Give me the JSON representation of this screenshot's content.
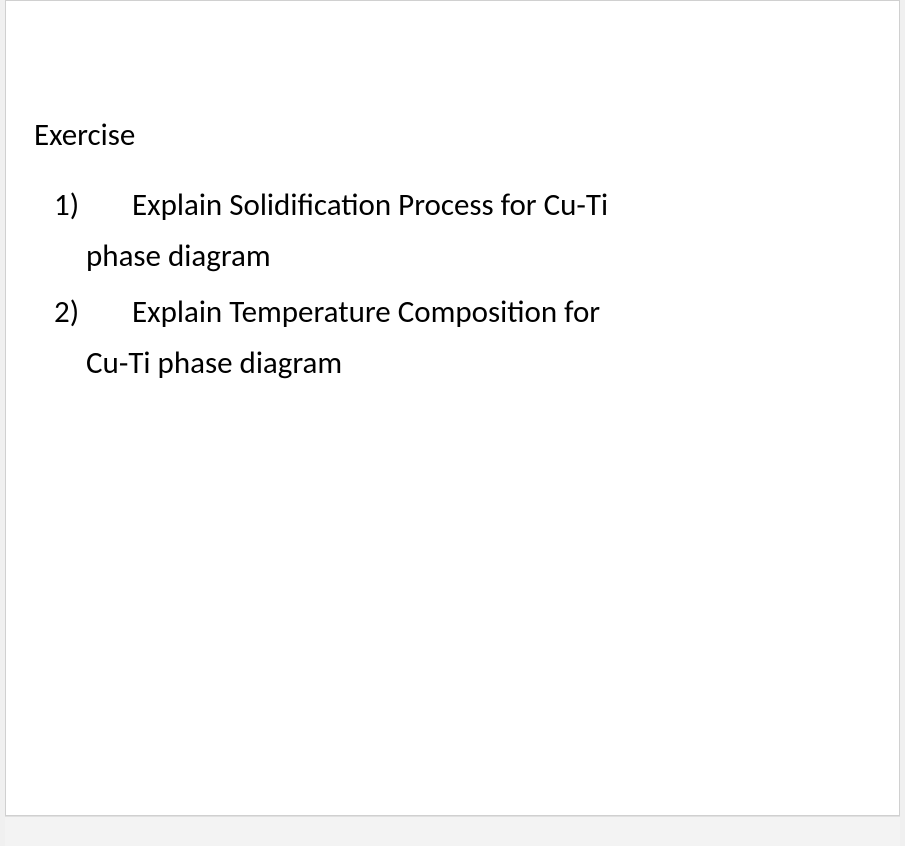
{
  "document": {
    "heading": "Exercise",
    "items": [
      {
        "number": "1)",
        "line1_prefix": "Explain Solidification Process for Cu-",
        "line1_error": "Ti",
        "line1_suffix": "",
        "line2": "phase diagram"
      },
      {
        "number": "2)",
        "line1_prefix": "Explain Temperature Composition for",
        "line1_error": "",
        "line1_suffix": "",
        "line2_prefix": "Cu-",
        "line2_error": "Ti",
        "line2_suffix": " phase diagram"
      }
    ]
  }
}
